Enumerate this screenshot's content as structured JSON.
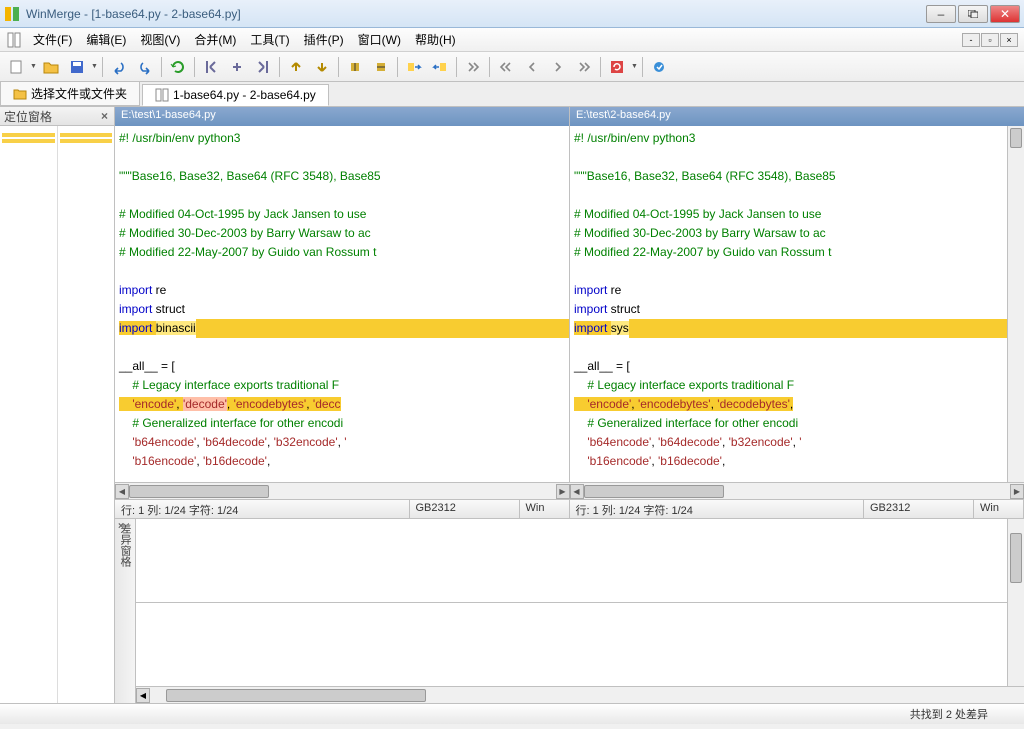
{
  "title": "WinMerge - [1-base64.py - 2-base64.py]",
  "menu": {
    "file": "文件(F)",
    "edit": "编辑(E)",
    "view": "视图(V)",
    "merge": "合并(M)",
    "tools": "工具(T)",
    "plugins": "插件(P)",
    "window": "窗口(W)",
    "help": "帮助(H)"
  },
  "tabs": {
    "select": "选择文件或文件夹",
    "compare": "1-base64.py - 2-base64.py"
  },
  "panes": {
    "locator_title": "定位窗格",
    "diff_title": "差异窗格"
  },
  "left": {
    "path": "E:\\test\\1-base64.py",
    "code": {
      "shebang": "#! /usr/bin/env python3",
      "docstring": "\"\"\"Base16, Base32, Base64 (RFC 3548), Base85",
      "c1": "# Modified 04-Oct-1995 by Jack Jansen to use",
      "c2": "# Modified 30-Dec-2003 by Barry Warsaw to ac",
      "c3": "# Modified 22-May-2007 by Guido van Rossum t",
      "imp1a": "import",
      "imp1b": " re",
      "imp2a": "import",
      "imp2b": " struct",
      "imp3a": "import ",
      "imp3b": "binascii",
      "all_assign": "__all__ = [",
      "lc1": "    # Legacy interface exports traditional F",
      "lc2a": "    ",
      "lc2b": "'encode'",
      "lc2c": ", ",
      "lc2d": "'decode'",
      "lc2e": ", ",
      "lc2f": "'encodebytes'",
      "lc2g": ", ",
      "lc2h": "'decc",
      "lc3": "    # Generalized interface for other encodi",
      "lc4a": "    'b64encode'",
      "lc4b": ", ",
      "lc4c": "'b64decode'",
      "lc4d": ", ",
      "lc4e": "'b32encode'",
      "lc4f": ", ",
      "lc4g": "'",
      "lc5a": "    'b16encode'",
      "lc5b": ", ",
      "lc5c": "'b16decode'",
      "lc5d": ","
    },
    "status": {
      "pos": "行: 1 列: 1/24 字符: 1/24",
      "enc": "GB2312",
      "eol": "Win"
    }
  },
  "right": {
    "path": "E:\\test\\2-base64.py",
    "code": {
      "shebang": "#! /usr/bin/env python3",
      "docstring": "\"\"\"Base16, Base32, Base64 (RFC 3548), Base85",
      "c1": "# Modified 04-Oct-1995 by Jack Jansen to use",
      "c2": "# Modified 30-Dec-2003 by Barry Warsaw to ac",
      "c3": "# Modified 22-May-2007 by Guido van Rossum t",
      "imp1a": "import",
      "imp1b": " re",
      "imp2a": "import",
      "imp2b": " struct",
      "imp3a": "import ",
      "imp3b": "sys",
      "all_assign": "__all__ = [",
      "lc1": "    # Legacy interface exports traditional F",
      "lc2a": "    ",
      "lc2b": "'encode'",
      "lc2c": ", ",
      "lc2d": "'encodebytes'",
      "lc2e": ", ",
      "lc2f": "'decodebytes'",
      "lc2g": ",",
      "lc3": "    # Generalized interface for other encodi",
      "lc4a": "    'b64encode'",
      "lc4b": ", ",
      "lc4c": "'b64decode'",
      "lc4d": ", ",
      "lc4e": "'b32encode'",
      "lc4f": ", ",
      "lc4g": "'",
      "lc5a": "    'b16encode'",
      "lc5b": ", ",
      "lc5c": "'b16decode'",
      "lc5d": ","
    },
    "status": {
      "pos": "行: 1 列: 1/24 字符: 1/24",
      "enc": "GB2312",
      "eol": "Win"
    }
  },
  "statusbar": "共找到 2 处差异"
}
